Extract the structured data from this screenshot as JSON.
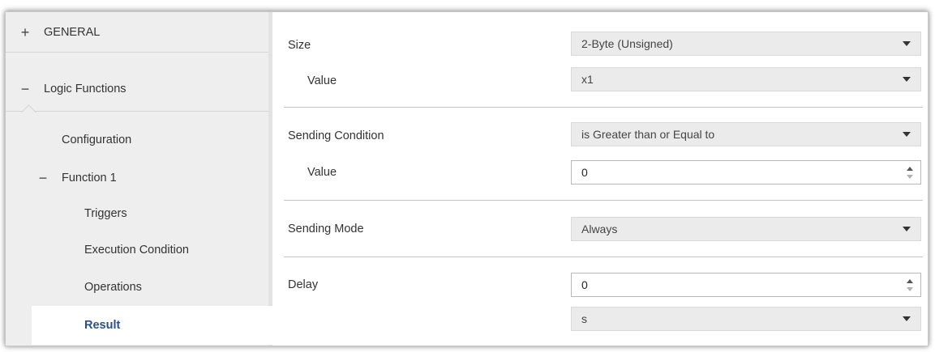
{
  "sidebar": {
    "general": {
      "toggle": "+",
      "label": "GENERAL"
    },
    "logic_functions": {
      "toggle": "−",
      "label": "Logic Functions"
    },
    "configuration": {
      "label": "Configuration"
    },
    "function1": {
      "toggle": "−",
      "label": "Function 1"
    },
    "triggers": {
      "label": "Triggers"
    },
    "execution_condition": {
      "label": "Execution Condition"
    },
    "operations": {
      "label": "Operations"
    },
    "result": {
      "label": "Result"
    }
  },
  "form": {
    "size": {
      "label": "Size",
      "value": "2-Byte (Unsigned)"
    },
    "size_value": {
      "label": "Value",
      "value": "x1"
    },
    "sending_condition": {
      "label": "Sending Condition",
      "value": "is Greater than or Equal to"
    },
    "condition_value": {
      "label": "Value",
      "value": "0"
    },
    "sending_mode": {
      "label": "Sending Mode",
      "value": "Always"
    },
    "delay": {
      "label": "Delay",
      "value": "0"
    },
    "delay_unit": {
      "value": "s"
    }
  },
  "icons": {
    "select_arrow": "chevron-down-icon",
    "spin_up": "spin-up-icon",
    "spin_down": "spin-down-icon"
  },
  "colors": {
    "active_item_text": "#2a4f8f",
    "sidebar_bg": "#eeeeee",
    "select_bg": "#ebebeb"
  }
}
